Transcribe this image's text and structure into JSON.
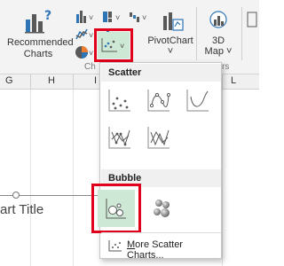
{
  "ribbon": {
    "recommended_charts": "Recommended Charts",
    "pivotchart": "PivotChart",
    "map_3d_line1": "3D",
    "map_3d_line2": "Map",
    "group_charts": "Ch",
    "group_tours": "rs",
    "chevron": "˅"
  },
  "columns": [
    "G",
    "H",
    "I",
    "L"
  ],
  "chart": {
    "title": "art Title"
  },
  "dropdown": {
    "scatter_header": "Scatter",
    "bubble_header": "Bubble",
    "more_label": "More Scatter Charts..."
  },
  "colors": {
    "highlight_border": "#e0001b",
    "selected_fill": "#cde8d4",
    "icon_dark": "#595959",
    "accent_blue": "#2e75b6",
    "accent_orange": "#ed7d31"
  }
}
